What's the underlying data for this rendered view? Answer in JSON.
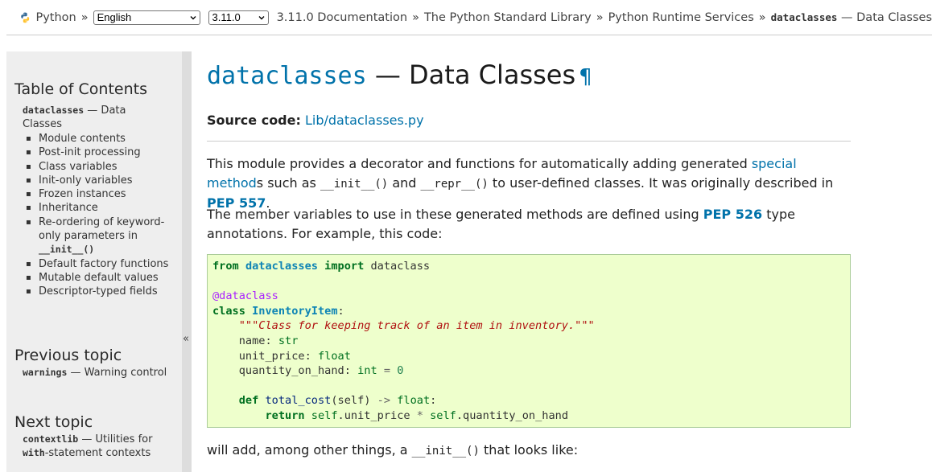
{
  "topbar": {
    "python_label": "Python",
    "sep": "»",
    "language_select": "English",
    "version_select": "3.11.0",
    "breadcrumbs": [
      "3.11.0 Documentation",
      "The Python Standard Library",
      "Python Runtime Services"
    ],
    "current_code": "dataclasses",
    "current_rest": " — Data Classes"
  },
  "sidebar": {
    "toc_heading": "Table of Contents",
    "toc_top_code": "dataclasses",
    "toc_top_rest": " — Data Classes",
    "toc_items": [
      "Module contents",
      "Post-init processing",
      "Class variables",
      "Init-only variables",
      "Frozen instances",
      "Inheritance",
      "Re-ordering of keyword-only parameters in",
      "Default factory functions",
      "Mutable default values",
      "Descriptor-typed fields"
    ],
    "toc_item_code": "__init__()",
    "prev_heading": "Previous topic",
    "prev_code": "warnings",
    "prev_rest": " — Warning control",
    "next_heading": "Next topic",
    "next_code": "contextlib",
    "next_rest": " — Utilities for",
    "next_code2": "with",
    "next_rest2": "-statement contexts",
    "collapse": "«"
  },
  "main": {
    "title_code": "dataclasses",
    "title_rest": " — Data Classes",
    "pilcrow": "¶",
    "source_label": "Source code:",
    "source_link": "Lib/dataclasses.py",
    "p1": {
      "a": "This module provides a decorator and functions for automatically adding generated ",
      "link": "special method",
      "b": "s such as ",
      "code1": "__init__()",
      "c": " and ",
      "code2": "__repr__()",
      "d": " to user-defined classes. It was originally described in ",
      "pep": "PEP 557",
      "e": "."
    },
    "p2": {
      "a": "The member variables to use in these generated methods are defined using ",
      "pep": "PEP 526",
      "b": " type annotations. For example, this code:"
    },
    "code": {
      "from": "from",
      "module": "dataclasses",
      "import": "import",
      "name": "dataclass",
      "decorator": "@dataclass",
      "class_kw": "class",
      "class_name": "InventoryItem",
      "colon": ":",
      "docstring": "\"\"\"Class for keeping track of an item in inventory.\"\"\"",
      "f1": "name",
      "t1": "str",
      "f2": "unit_price",
      "t2": "float",
      "f3": "quantity_on_hand",
      "t3": "int",
      "eq": "=",
      "zero": "0",
      "def": "def",
      "method": "total_cost",
      "self": "self",
      "arrow": "->",
      "ret_type": "float",
      "return": "return",
      "attr1": ".unit_price ",
      "star": "*",
      "attr2": ".quantity_on_hand"
    },
    "p3": {
      "a": "will add, among other things, a ",
      "code": "__init__()",
      "b": " that looks like:"
    }
  }
}
